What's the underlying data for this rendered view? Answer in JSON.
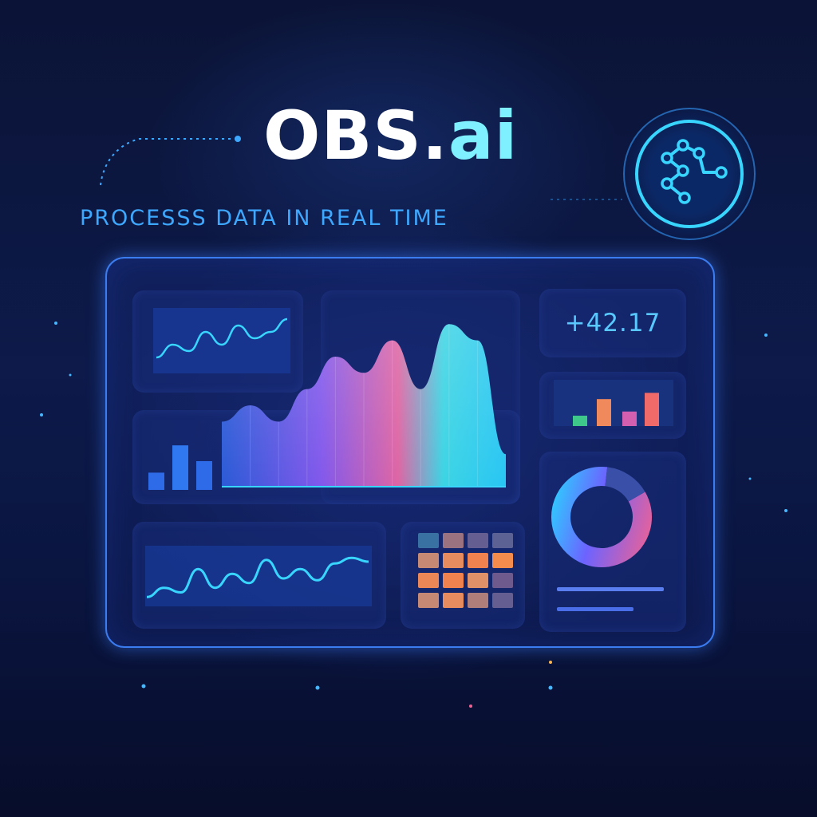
{
  "brand": {
    "name_main": "OBS.",
    "name_suffix": "ai",
    "tagline": "PROCESSS DATA IN REAL TIME"
  },
  "metric": {
    "value": "+42.17"
  },
  "icons": {
    "badge": "network-nodes-icon"
  },
  "colors": {
    "background": "#0a1233",
    "accent_cyan": "#38e8ff",
    "accent_blue": "#3b7cf0",
    "accent_purple": "#8b5cf6",
    "accent_pink": "#f06292",
    "title": "#ffffff"
  },
  "chart_data": [
    {
      "type": "line",
      "values": [
        3,
        5,
        4,
        7,
        5,
        8,
        6,
        7,
        9
      ],
      "title": "",
      "xlabel": "",
      "ylabel": ""
    },
    {
      "type": "area",
      "values": [
        4,
        5,
        4,
        6,
        8,
        7,
        9,
        6,
        10,
        9,
        2
      ],
      "title": "",
      "xlabel": "",
      "ylabel": ""
    },
    {
      "type": "bar",
      "values": [
        1.2,
        3.1,
        2.0
      ],
      "title": "",
      "xlabel": "",
      "ylabel": ""
    },
    {
      "type": "bar",
      "values": [
        1.0,
        2.6,
        1.4,
        3.2
      ],
      "title": "",
      "xlabel": "",
      "ylabel": ""
    },
    {
      "type": "line",
      "values": [
        2,
        3,
        2.5,
        5,
        3,
        4.5,
        3.5,
        6,
        4,
        5,
        3.8,
        5.6,
        6.2,
        5.8
      ],
      "title": "",
      "xlabel": "",
      "ylabel": ""
    },
    {
      "type": "heatmap",
      "rows": 4,
      "cols": 4,
      "values": [
        [
          0.1,
          0.5,
          0.35,
          0.3
        ],
        [
          0.6,
          0.75,
          0.85,
          0.9
        ],
        [
          0.8,
          0.85,
          0.7,
          0.4
        ],
        [
          0.6,
          0.75,
          0.55,
          0.35
        ]
      ],
      "title": ""
    },
    {
      "type": "pie",
      "values": [
        85,
        15
      ],
      "title": ""
    }
  ]
}
